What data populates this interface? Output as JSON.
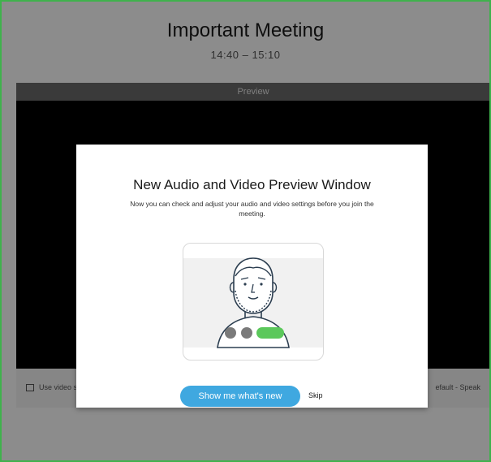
{
  "meeting": {
    "title": "Important Meeting",
    "time": "14:40 – 15:10"
  },
  "preview": {
    "label": "Preview",
    "footer_left": "Use video s",
    "footer_right": "efault - Speak"
  },
  "modal": {
    "title": "New Audio and Video Preview Window",
    "description": "Now you can check and adjust your audio and video settings before you join the meeting.",
    "primary_button": "Show me what's new",
    "skip_label": "Skip"
  },
  "colors": {
    "frame_border": "#3fb24c",
    "primary_button": "#3fa8e0",
    "toggle_on": "#5bc85b",
    "toggle_off": "#7a7a7a"
  },
  "icons": [
    "video-settings-icon",
    "person-illustration",
    "mute-dot-icon",
    "video-dot-icon",
    "toggle-pill-icon"
  ]
}
